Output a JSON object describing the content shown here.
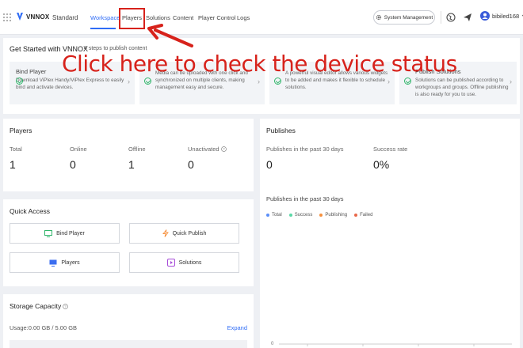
{
  "header": {
    "brand": "VNNOX",
    "edition": "Standard",
    "nav": [
      {
        "label": "Workspace",
        "active": true
      },
      {
        "label": "Players",
        "active": false
      },
      {
        "label": "Solutions",
        "active": false
      },
      {
        "label": "Content",
        "active": false
      },
      {
        "label": "Player Control",
        "active": false
      },
      {
        "label": "Logs",
        "active": false
      }
    ],
    "system_management": "System Management",
    "user_name": "bibiled168",
    "icons": [
      "grid-icon",
      "logo-icon",
      "gear-icon",
      "globe-icon",
      "send-icon",
      "user-icon",
      "chevron-down-icon"
    ]
  },
  "annotation": {
    "text": "Click here to check the device status",
    "color": "#d7221b"
  },
  "get_started": {
    "title": "Get Started with VNNOX",
    "subtitle": "4 steps to publish content",
    "cards": [
      {
        "title": "Bind Player",
        "desc": "Download ViPlex Handy/ViPlex Express to easily bind and activate devices."
      },
      {
        "title": "",
        "desc": "Media can be uploaded with one click and synchronized on multiple clients, making management easy and secure."
      },
      {
        "title": "",
        "desc": "A powerful visual editor allows various widgets to be added and makes it flexible to schedule solutions."
      },
      {
        "title": "Publish Solutions",
        "desc": "Solutions can be published according to workgroups and groups. Offline publishing is also ready for you to use."
      }
    ]
  },
  "players": {
    "title": "Players",
    "stats": [
      {
        "label": "Total",
        "value": "1"
      },
      {
        "label": "Online",
        "value": "0"
      },
      {
        "label": "Offline",
        "value": "1"
      },
      {
        "label": "Unactivated",
        "value": "0"
      }
    ]
  },
  "quick_access": {
    "title": "Quick Access",
    "buttons": [
      {
        "label": "Bind Player",
        "icon": "monitor-plus-icon"
      },
      {
        "label": "Quick Publish",
        "icon": "lightning-icon"
      },
      {
        "label": "Players",
        "icon": "monitor-icon"
      },
      {
        "label": "Solutions",
        "icon": "play-icon"
      }
    ]
  },
  "storage": {
    "title": "Storage Capacity",
    "usage": "Usage:0.00 GB / 5.00 GB",
    "used_fraction": 0,
    "expand": "Expand"
  },
  "publishes": {
    "title": "Publishes",
    "past_label": "Publishes in the past 30 days",
    "past_value": "0",
    "success_label": "Success rate",
    "success_value": "0%",
    "chart_title": "Publishes in the past 30 days",
    "legend": [
      {
        "label": "Total",
        "color": "#5b8ff9"
      },
      {
        "label": "Success",
        "color": "#5ad8a6"
      },
      {
        "label": "Publishing",
        "color": "#f6903d"
      },
      {
        "label": "Failed",
        "color": "#e8684a"
      }
    ],
    "axis_zero": "0"
  },
  "colors": {
    "accent": "#2f6cf6",
    "annotation_red": "#d7221b",
    "success_green": "#30b56a"
  }
}
